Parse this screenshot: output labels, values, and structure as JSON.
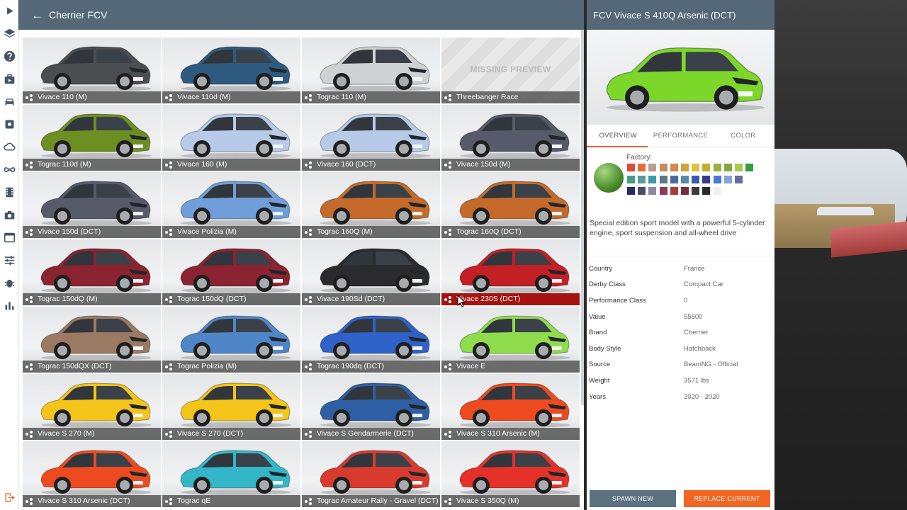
{
  "header": {
    "back_glyph": "←",
    "title": "Cherrier FCV"
  },
  "toolbar": [
    "play-icon",
    "layers-icon",
    "help-icon",
    "briefcase-icon",
    "car-icon",
    "settings-icon",
    "cloud-icon",
    "infinity-icon",
    "film-icon",
    "camera-icon",
    "window-icon",
    "sliders-icon",
    "bug-icon",
    "stats-icon"
  ],
  "toolbar_bottom": "exit-icon",
  "missing_preview": "MISSING PREVIEW",
  "configs": [
    {
      "label": "Vivace 110 (M)",
      "color": "#4b4d50"
    },
    {
      "label": "Vivace 110d (M)",
      "color": "#2f5a80"
    },
    {
      "label": "Tograc 110 (M)",
      "color": "#cfd1d3"
    },
    {
      "label": "Threebanger Race",
      "color": null
    },
    {
      "label": "Tograc 110d (M)",
      "color": "#6c8f22"
    },
    {
      "label": "Vivace 160 (M)",
      "color": "#b7cbe8"
    },
    {
      "label": "Vivace 160 (DCT)",
      "color": "#b7cbe8"
    },
    {
      "label": "Vivace 150d (M)",
      "color": "#565a69"
    },
    {
      "label": "Vivace 150d (DCT)",
      "color": "#565a69"
    },
    {
      "label": "Vivace Polizia (M)",
      "color": "#6f9ed8"
    },
    {
      "label": "Tograc 160Q (M)",
      "color": "#c46a2b"
    },
    {
      "label": "Tograc 160Q (DCT)",
      "color": "#c46a2b"
    },
    {
      "label": "Tograc 150dQ (M)",
      "color": "#8c2330"
    },
    {
      "label": "Tograc 150dQ (DCT)",
      "color": "#8c2330"
    },
    {
      "label": "Vivace 190Sd (DCT)",
      "color": "#2b2b2d"
    },
    {
      "label": "Vivace 230S (DCT)",
      "color": "#c41f24"
    },
    {
      "label": "Tograc 150dQX (DCT)",
      "color": "#9a7a63"
    },
    {
      "label": "Tograc Polizia (M)",
      "color": "#4f86c8"
    },
    {
      "label": "Tograc 190dq (DCT)",
      "color": "#2e62c8"
    },
    {
      "label": "Vivace E",
      "color": "#8fdc4c"
    },
    {
      "label": "Vivace S 270 (M)",
      "color": "#f3c41a"
    },
    {
      "label": "Vivace S 270 (DCT)",
      "color": "#f3c41a"
    },
    {
      "label": "Vivace S Gendarmerie (DCT)",
      "color": "#2e5fa4"
    },
    {
      "label": "Vivace S 310 Arsenic (M)",
      "color": "#ee4a1f"
    },
    {
      "label": "Vivace S 310 Arsenic (DCT)",
      "color": "#ee4a1f"
    },
    {
      "label": "Tograc qE",
      "color": "#33b6c8"
    },
    {
      "label": "Tograc Amateur Rally - Gravel (DCT)",
      "color": "#d93a2e"
    },
    {
      "label": "Vivace S 350Q (M)",
      "color": "#e6302a"
    }
  ],
  "detail": {
    "title": "FCV Vivace S 410Q Arsenic (DCT)",
    "preview_color": "#7dd62a",
    "tabs": [
      "OVERVIEW",
      "PERFORMANCE",
      "COLOR"
    ],
    "factory_label": "Factory:",
    "swatches": [
      "#e0473b",
      "#e86a3a",
      "#b9a08a",
      "#c98a5a",
      "#d08a4a",
      "#d6a03a",
      "#e0c040",
      "#c0b030",
      "#9ab040",
      "#8aa83a",
      "#a8c850",
      "#3a9a3a",
      "#4a9a8a",
      "#5a9a9a",
      "#3a9aa8",
      "#5a7a8a",
      "#4a6a9a",
      "#5a8ab0",
      "#3a5ab8",
      "#3a3a8a",
      "#4a7ad0",
      "#8aa0d8",
      "#6a6a9a",
      "#2a2a5a",
      "#4a4a6a",
      "#8a8aa0",
      "#8a3a5a",
      "#a83a3a",
      "#7a2a3a",
      "#3a3a3a",
      "#2a2a2a",
      "#f0f0f0"
    ],
    "description": "Special edition sport model with a powerful 5-cylinder engine, sport suspension and all-wheel drive",
    "properties": [
      {
        "k": "Country",
        "v": "France"
      },
      {
        "k": "Derby Class",
        "v": "Compact Car"
      },
      {
        "k": "Performance Class",
        "v": "0"
      },
      {
        "k": "Value",
        "v": "55600"
      },
      {
        "k": "Brand",
        "v": "Cherrier"
      },
      {
        "k": "Body Style",
        "v": "Hatchback"
      },
      {
        "k": "Source",
        "v": "BeamNG - Official"
      },
      {
        "k": "Weight",
        "v": "3571 lbs"
      },
      {
        "k": "Years",
        "v": "2020 - 2020"
      }
    ],
    "spawn_label": "SPAWN NEW",
    "replace_label": "REPLACE CURRENT"
  },
  "selected_index": 15
}
